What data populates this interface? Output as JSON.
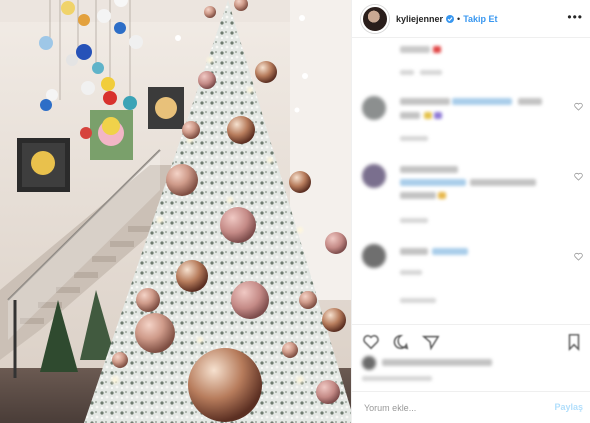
{
  "header": {
    "username": "kyliejenner",
    "dot": "•",
    "follow_label": "Takip Et",
    "more_label": "•••"
  },
  "comment_box": {
    "placeholder": "Yorum ekle...",
    "share_label": "Paylaş"
  },
  "icons": {
    "verified": "verified-badge-icon",
    "like": "heart-icon",
    "comment": "comment-icon",
    "share": "share-icon",
    "save": "bookmark-icon",
    "more": "more-icon"
  },
  "colors": {
    "link_blue": "#3897f0",
    "share_disabled": "#b2dffc",
    "text": "#262626",
    "divider": "#efefef"
  }
}
